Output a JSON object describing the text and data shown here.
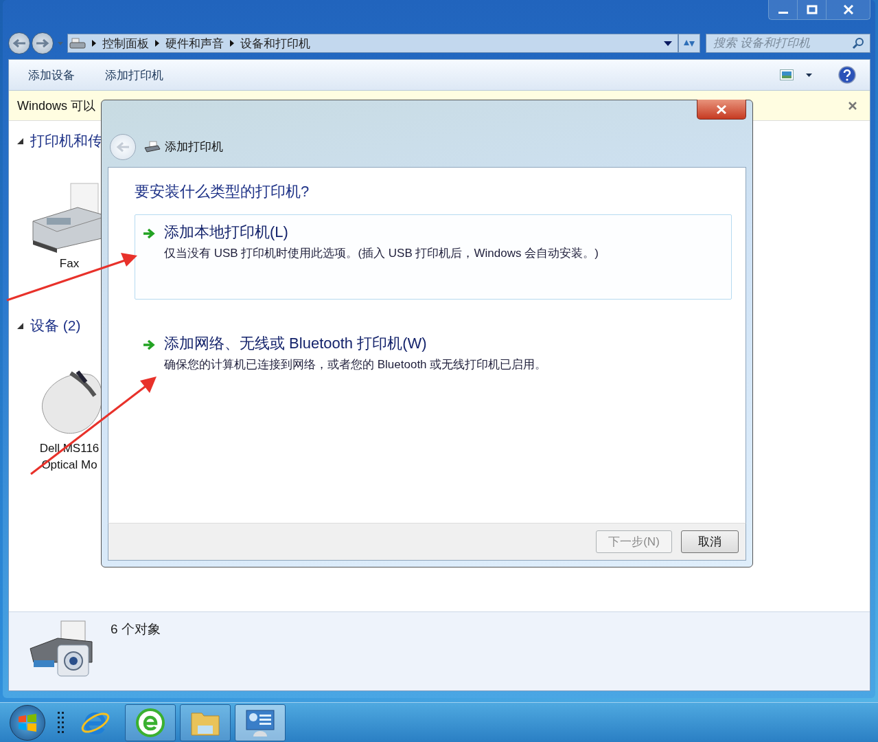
{
  "address_bar": {
    "crumbs": [
      "控制面板",
      "硬件和声音",
      "设备和打印机"
    ]
  },
  "search": {
    "placeholder": "搜索 设备和打印机"
  },
  "toolbar": {
    "buttons": [
      "添加设备",
      "添加打印机"
    ]
  },
  "info_bar": {
    "text": "Windows 可以"
  },
  "groups": [
    {
      "title": "打印机和传",
      "expanded": true,
      "items": [
        {
          "kind": "fax",
          "lines": [
            "Fax"
          ]
        }
      ]
    },
    {
      "title": "设备 (2)",
      "expanded": true,
      "items": [
        {
          "kind": "mouse",
          "lines": [
            "Dell MS116",
            "Optical Mo"
          ]
        }
      ]
    }
  ],
  "details": {
    "text": "6 个对象"
  },
  "dialog": {
    "title": "添加打印机",
    "question": "要安装什么类型的打印机?",
    "options": [
      {
        "title": "添加本地打印机(L)",
        "description": "仅当没有 USB 打印机时使用此选项。(插入 USB 打印机后，Windows 会自动安装。)",
        "selected": true
      },
      {
        "title": "添加网络、无线或 Bluetooth 打印机(W)",
        "description": "确保您的计算机已连接到网络，或者您的 Bluetooth 或无线打印机已启用。",
        "selected": false
      }
    ],
    "buttons": [
      {
        "label": "下一步(N)",
        "disabled": true
      },
      {
        "label": "取消",
        "disabled": false
      }
    ]
  }
}
